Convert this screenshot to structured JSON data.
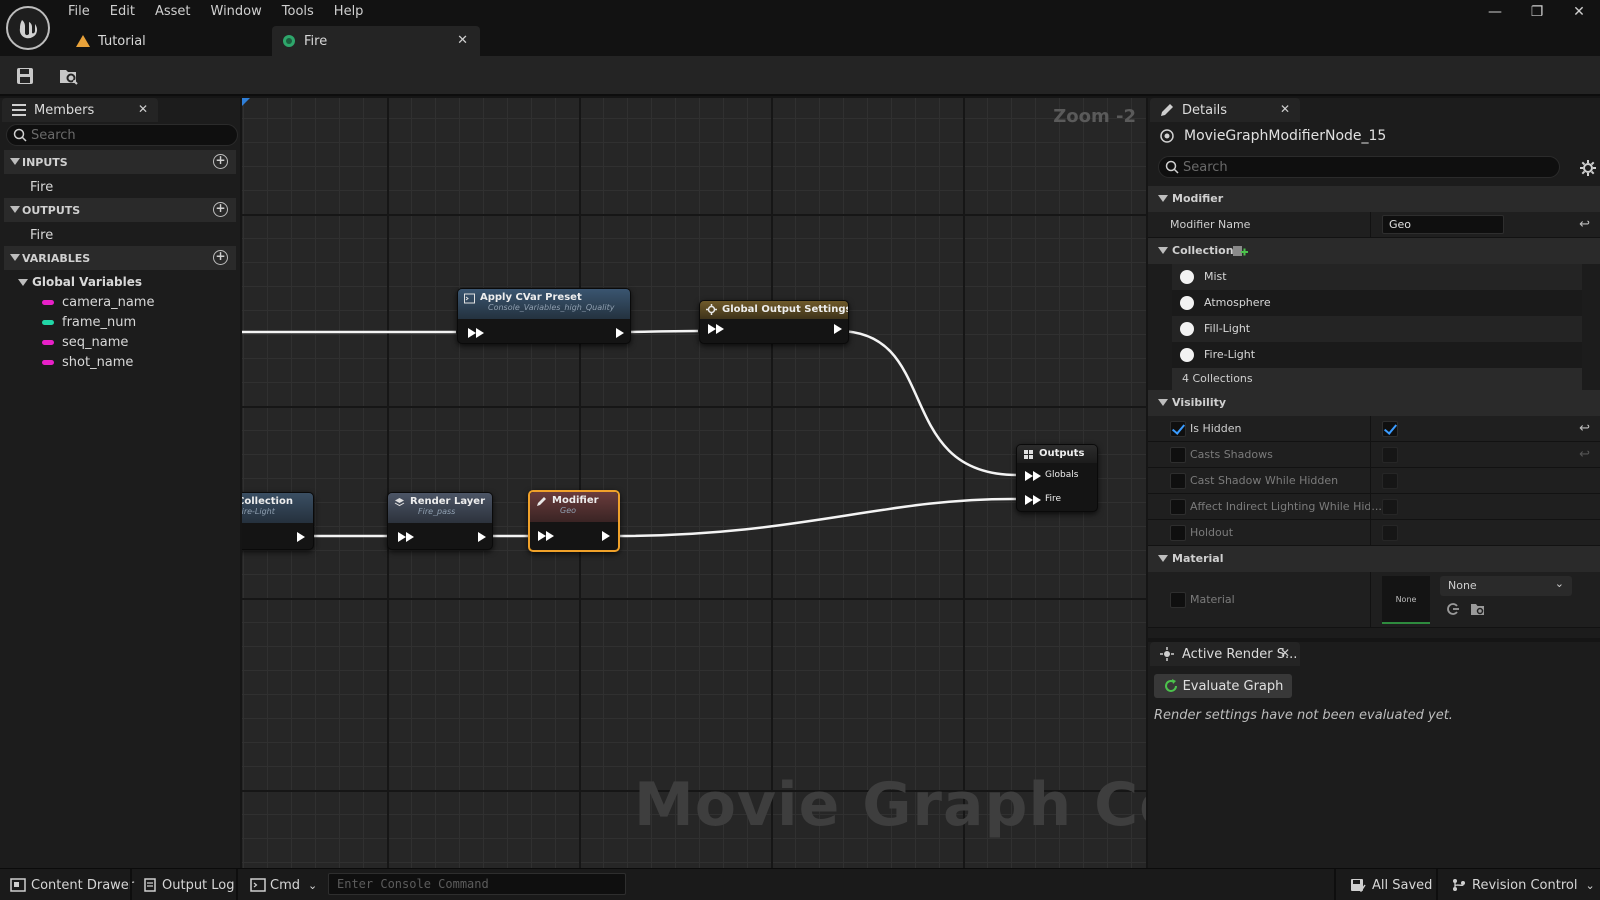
{
  "menu": [
    "File",
    "Edit",
    "Asset",
    "Window",
    "Tools",
    "Help"
  ],
  "tabs": [
    {
      "label": "Tutorial",
      "active": false
    },
    {
      "label": "Fire",
      "active": true
    }
  ],
  "members": {
    "tab_label": "Members",
    "search_placeholder": "Search",
    "inputs_header": "INPUTS",
    "inputs": [
      "Fire"
    ],
    "outputs_header": "OUTPUTS",
    "outputs": [
      "Fire"
    ],
    "variables_header": "VARIABLES",
    "global_group": "Global Variables",
    "variables": [
      {
        "name": "camera_name",
        "color": "#e820c8"
      },
      {
        "name": "frame_num",
        "color": "#21d6a6"
      },
      {
        "name": "seq_name",
        "color": "#e820c8"
      },
      {
        "name": "shot_name",
        "color": "#e820c8"
      }
    ]
  },
  "graph": {
    "zoom_label": "Zoom -2",
    "watermark": "Movie Graph Config",
    "nodes": {
      "apply_cvar": {
        "title": "Apply CVar Preset",
        "subtitle": "Console_Variables_high_Quality"
      },
      "global_output": {
        "title": "Global Output Settings"
      },
      "collection": {
        "title": "Collection",
        "subtitle": "Fire-Light"
      },
      "render_layer": {
        "title": "Render Layer",
        "subtitle": "Fire_pass"
      },
      "modifier": {
        "title": "Modifier",
        "subtitle": "Geo"
      },
      "outputs": {
        "title": "Outputs",
        "pins": [
          "Globals",
          "Fire"
        ]
      }
    }
  },
  "details": {
    "tab_label": "Details",
    "object_name": "MovieGraphModifierNode_15",
    "search_placeholder": "Search",
    "modifier_cat": "Modifier",
    "modifier_name_label": "Modifier Name",
    "modifier_name_value": "Geo",
    "collections_cat": "Collections",
    "collections": [
      "Mist",
      "Atmosphere",
      "Fill-Light",
      "Fire-Light"
    ],
    "collections_count": "4 Collections",
    "visibility_cat": "Visibility",
    "visibility": [
      {
        "label": "Is Hidden",
        "enabled": true,
        "checked": true
      },
      {
        "label": "Casts Shadows",
        "enabled": false,
        "checked": false
      },
      {
        "label": "Cast Shadow While Hidden",
        "enabled": false,
        "checked": false
      },
      {
        "label": "Affect Indirect Lighting While Hid...",
        "enabled": false,
        "checked": false
      },
      {
        "label": "Holdout",
        "enabled": false,
        "checked": false
      }
    ],
    "material_cat": "Material",
    "material_label": "Material",
    "material_thumb": "None",
    "material_value": "None"
  },
  "render": {
    "tab_label": "Active Render S...",
    "evaluate_label": "Evaluate Graph",
    "message": "Render settings have not been evaluated yet."
  },
  "status": {
    "content_drawer": "Content Drawer",
    "output_log": "Output Log",
    "cmd": "Cmd",
    "console_placeholder": "Enter Console Command",
    "all_saved": "All Saved",
    "revision_control": "Revision Control"
  },
  "colors": {
    "accent_blue": "#3b9cff",
    "selection_orange": "#f0a12a",
    "exec_white": "#ffffff"
  }
}
